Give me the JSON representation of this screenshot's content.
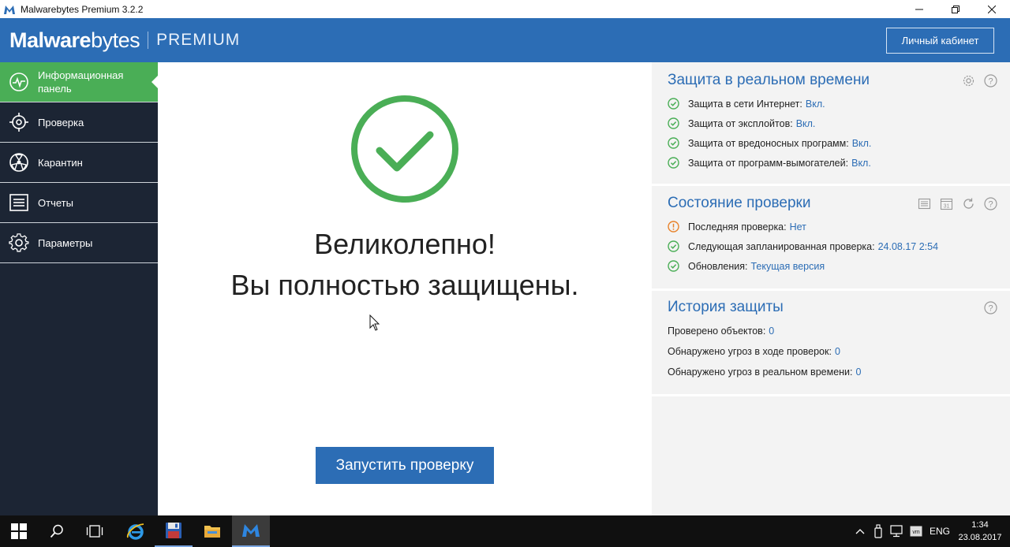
{
  "window": {
    "title": "Malwarebytes Premium 3.2.2"
  },
  "header": {
    "brand_bold": "Malware",
    "brand_light": "bytes",
    "edition": "PREMIUM",
    "account_button": "Личный кабинет"
  },
  "sidebar": {
    "items": [
      {
        "label": "Информационная панель",
        "icon": "dashboard-icon",
        "active": true
      },
      {
        "label": "Проверка",
        "icon": "scan-target-icon"
      },
      {
        "label": "Карантин",
        "icon": "quarantine-icon"
      },
      {
        "label": "Отчеты",
        "icon": "reports-icon"
      },
      {
        "label": "Параметры",
        "icon": "settings-icon"
      }
    ]
  },
  "main": {
    "headline1": "Великолепно!",
    "headline2": "Вы полностью защищены.",
    "scan_button": "Запустить проверку"
  },
  "realtime": {
    "title": "Защита в реальном времени",
    "rows": [
      {
        "label": "Защита в сети Интернет:",
        "value": "Вкл."
      },
      {
        "label": "Защита от эксплойтов:",
        "value": "Вкл."
      },
      {
        "label": "Защита от вредоносных программ:",
        "value": "Вкл."
      },
      {
        "label": "Защита от программ-вымогателей:",
        "value": "Вкл."
      }
    ]
  },
  "scan_status": {
    "title": "Состояние проверки",
    "rows": [
      {
        "label": "Последняя проверка:",
        "value": "Нет",
        "status": "warning"
      },
      {
        "label": "Следующая запланированная проверка:",
        "value": "24.08.17 2:54",
        "status": "ok"
      },
      {
        "label": "Обновления:",
        "value": "Текущая версия",
        "status": "ok"
      }
    ]
  },
  "history": {
    "title": "История защиты",
    "rows": [
      {
        "label": "Проверено объектов:",
        "value": "0"
      },
      {
        "label": "Обнаружено угроз в ходе проверок:",
        "value": "0"
      },
      {
        "label": "Обнаружено угроз в реальном времени:",
        "value": "0"
      }
    ]
  },
  "taskbar": {
    "lang": "ENG",
    "time": "1:34",
    "date": "23.08.2017"
  },
  "colors": {
    "brand_blue": "#2c6db5",
    "active_green": "#4aae56",
    "sidebar_dark": "#1c2534",
    "ok_green": "#4aae56",
    "warn_orange": "#e8822a"
  }
}
